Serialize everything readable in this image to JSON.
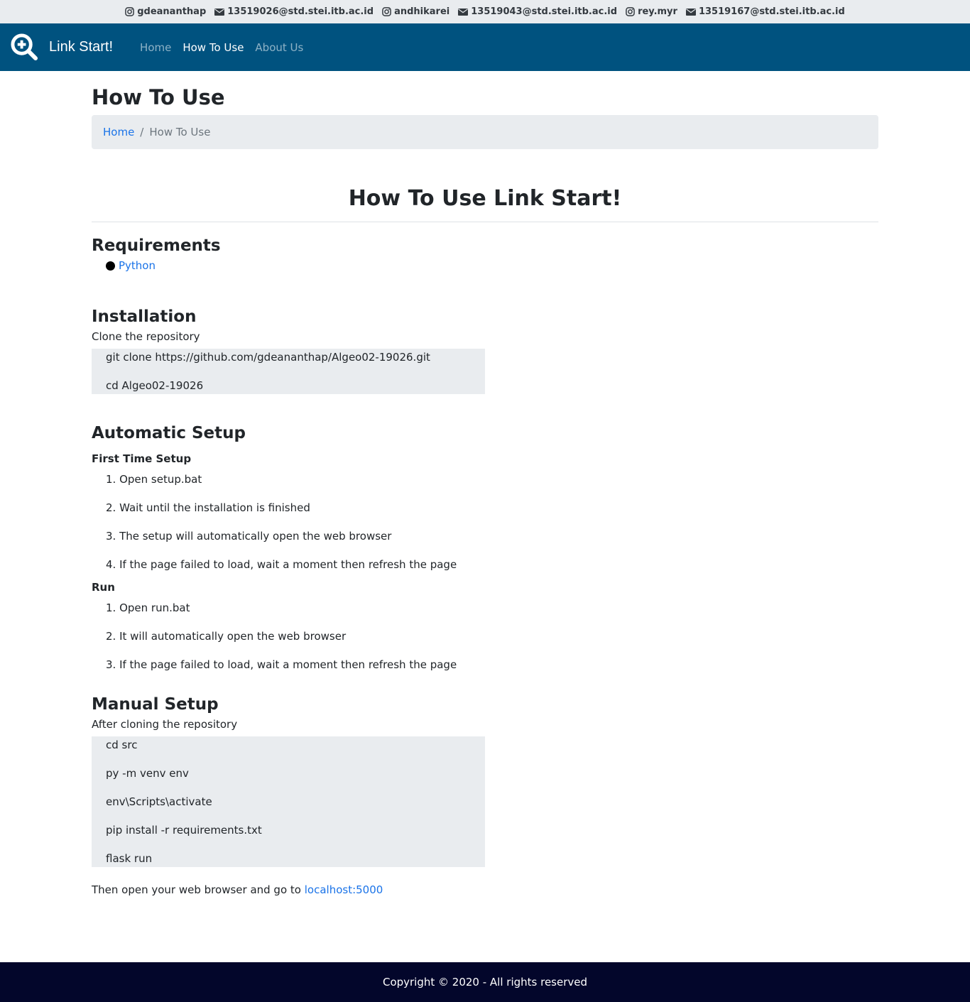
{
  "topbar": {
    "contacts": [
      {
        "type": "instagram",
        "label": "gdeananthap"
      },
      {
        "type": "email",
        "label": "13519026@std.stei.itb.ac.id"
      },
      {
        "type": "instagram",
        "label": "andhikarei"
      },
      {
        "type": "email",
        "label": "13519043@std.stei.itb.ac.id"
      },
      {
        "type": "instagram",
        "label": "rey.myr"
      },
      {
        "type": "email",
        "label": "13519167@std.stei.itb.ac.id"
      }
    ]
  },
  "navbar": {
    "brand": "Link Start!",
    "links": [
      {
        "label": "Home",
        "active": false
      },
      {
        "label": "How To Use",
        "active": true
      },
      {
        "label": "About Us",
        "active": false
      }
    ]
  },
  "page": {
    "title": "How To Use",
    "breadcrumb": {
      "home": "Home",
      "separator": "/",
      "current": "How To Use"
    },
    "heading": "How To Use Link Start!"
  },
  "requirements": {
    "title": "Requirements",
    "items": [
      "Python"
    ]
  },
  "installation": {
    "title": "Installation",
    "intro": "Clone the repository",
    "code": [
      "git clone https://github.com/gdeananthap/Algeo02-19026.git",
      "cd Algeo02-19026"
    ]
  },
  "automatic": {
    "title": "Automatic Setup",
    "first_time": {
      "title": "First Time Setup",
      "steps": [
        "1. Open setup.bat",
        "2. Wait until the installation is finished",
        "3. The setup will automatically open the web browser",
        "4. If the page failed to load, wait a moment then refresh the page"
      ]
    },
    "run": {
      "title": "Run",
      "steps": [
        "1. Open run.bat",
        "2. It will automatically open the web browser",
        "3. If the page failed to load, wait a moment then refresh the page"
      ]
    }
  },
  "manual": {
    "title": "Manual Setup",
    "intro": "After cloning the repository",
    "code": [
      "cd src",
      "py -m venv env",
      "env\\Scripts\\activate",
      "pip install -r requirements.txt",
      "flask run"
    ],
    "outro": "Then open your web browser and go to",
    "outro_link": "localhost:5000"
  },
  "footer": {
    "text": "Copyright © 2020 - All rights reserved"
  },
  "colors": {
    "navbar": "#00527f",
    "footer": "#03062b",
    "link": "#1a73e8",
    "panel": "#e9ecef"
  }
}
